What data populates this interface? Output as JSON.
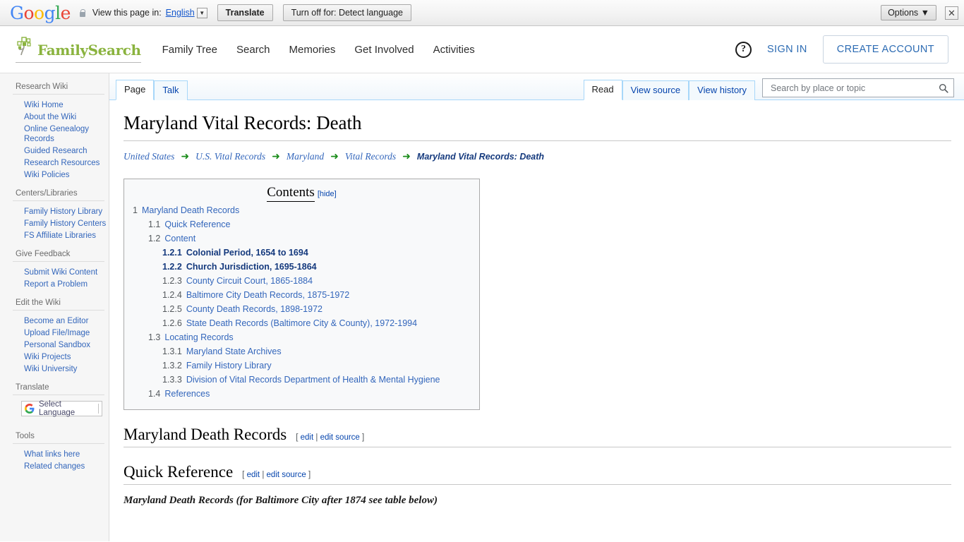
{
  "translate_bar": {
    "logo": "Google",
    "lock_icon": "lock-icon",
    "view_label": "View this page in:",
    "language": "English",
    "translate_button": "Translate",
    "turn_off_button": "Turn off for: Detect language",
    "options_button": "Options ▼",
    "close_icon": "✕"
  },
  "site_header": {
    "logo_text": "FamilySearch",
    "nav": [
      {
        "label": "Family Tree"
      },
      {
        "label": "Search"
      },
      {
        "label": "Memories"
      },
      {
        "label": "Get Involved"
      },
      {
        "label": "Activities"
      }
    ],
    "help_icon": "?",
    "sign_in": "SIGN IN",
    "create_account": "CREATE ACCOUNT"
  },
  "sidebar": {
    "sections": [
      {
        "title": "Research Wiki",
        "links": [
          "Wiki Home",
          "About the Wiki",
          "Online Genealogy Records",
          "Guided Research",
          "Research Resources",
          "Wiki Policies"
        ]
      },
      {
        "title": "Centers/Libraries",
        "links": [
          "Family History Library",
          "Family History Centers",
          "FS Affiliate Libraries"
        ]
      },
      {
        "title": "Give Feedback",
        "links": [
          "Submit Wiki Content",
          "Report a Problem"
        ]
      },
      {
        "title": "Edit the Wiki",
        "links": [
          "Become an Editor",
          "Upload File/Image",
          "Personal Sandbox",
          "Wiki Projects",
          "Wiki University"
        ]
      }
    ],
    "translate": {
      "title": "Translate",
      "select_language": "Select Language"
    },
    "tools": {
      "title": "Tools",
      "links": [
        "What links here",
        "Related changes"
      ]
    }
  },
  "tabs": {
    "left": [
      {
        "label": "Page",
        "active": true
      },
      {
        "label": "Talk",
        "active": false
      }
    ],
    "right": [
      {
        "label": "Read",
        "active": true
      },
      {
        "label": "View source",
        "active": false
      },
      {
        "label": "View history",
        "active": false
      }
    ]
  },
  "search": {
    "placeholder": "Search by place or topic",
    "value": "",
    "icon": "search-icon"
  },
  "page": {
    "title": "Maryland Vital Records: Death",
    "breadcrumb": [
      "United States",
      "U.S. Vital Records",
      "Maryland",
      "Vital Records",
      "Maryland Vital Records: Death"
    ],
    "breadcrumb_arrow": "➜"
  },
  "toc": {
    "title": "Contents",
    "hide_label": "[hide]",
    "items": [
      {
        "num": "1",
        "label": "Maryland Death Records",
        "level": 0,
        "bold": false
      },
      {
        "num": "1.1",
        "label": "Quick Reference",
        "level": 1,
        "bold": false
      },
      {
        "num": "1.2",
        "label": "Content",
        "level": 1,
        "bold": false
      },
      {
        "num": "1.2.1",
        "label": "Colonial Period, 1654 to 1694",
        "level": 2,
        "bold": true
      },
      {
        "num": "1.2.2",
        "label": "Church Jurisdiction, 1695-1864",
        "level": 2,
        "bold": true
      },
      {
        "num": "1.2.3",
        "label": "County Circuit Court, 1865-1884",
        "level": 2,
        "bold": false
      },
      {
        "num": "1.2.4",
        "label": "Baltimore City Death Records, 1875-1972",
        "level": 2,
        "bold": false
      },
      {
        "num": "1.2.5",
        "label": "County Death Records, 1898-1972",
        "level": 2,
        "bold": false
      },
      {
        "num": "1.2.6",
        "label": "State Death Records (Baltimore City & County), 1972-1994",
        "level": 2,
        "bold": false
      },
      {
        "num": "1.3",
        "label": "Locating Records",
        "level": 1,
        "bold": false
      },
      {
        "num": "1.3.1",
        "label": "Maryland State Archives",
        "level": 2,
        "bold": false
      },
      {
        "num": "1.3.2",
        "label": "Family History Library",
        "level": 2,
        "bold": false
      },
      {
        "num": "1.3.3",
        "label": "Division of Vital Records Department of Health & Mental Hygiene",
        "level": 2,
        "bold": false
      },
      {
        "num": "1.4",
        "label": "References",
        "level": 1,
        "bold": false
      }
    ]
  },
  "sections": [
    {
      "heading": "Maryland Death Records",
      "edit_open": "[",
      "edit": "edit",
      "edit_sep": "|",
      "edit_source": "edit source",
      "edit_close": "]"
    },
    {
      "heading": "Quick Reference",
      "edit_open": "[",
      "edit": "edit",
      "edit_sep": "|",
      "edit_source": "edit source",
      "edit_close": "]"
    }
  ],
  "quickref_intro": "Maryland Death Records (for Baltimore City after 1874 see table below)",
  "colors": {
    "brand_green": "#8ab33e",
    "link_blue": "#3366bb",
    "arrow_green": "#1a8c1a",
    "tab_border": "#a7d7f9"
  }
}
